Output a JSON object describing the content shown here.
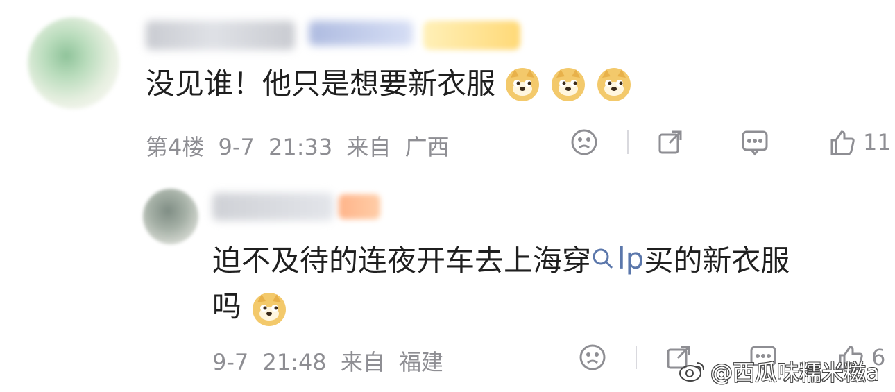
{
  "comment1": {
    "text": "没见谁！他只是想要新衣服",
    "emojis": [
      "doge",
      "doge",
      "doge"
    ],
    "meta": {
      "floor": "第4楼",
      "date": "9-7",
      "time": "21:33",
      "from_label": "来自",
      "location": "广西"
    },
    "actions": {
      "like_count": "11"
    }
  },
  "comment2": {
    "text_before": "迫不及待的连夜开车去上海穿",
    "link_text": "lp",
    "text_after": "买的新衣服",
    "line2": "吗",
    "emojis": [
      "doge"
    ],
    "meta": {
      "date": "9-7",
      "time": "21:48",
      "from_label": "来自",
      "location": "福建"
    },
    "actions": {
      "like_count": "6"
    }
  },
  "watermark": {
    "text": "@西瓜味糯米糍a"
  },
  "icons": [
    "avatar",
    "emoji-doge",
    "dislike-face-icon",
    "share-icon",
    "comment-icon",
    "thumb-up-icon",
    "search-link-icon",
    "weibo-logo"
  ],
  "colors": {
    "meta": "#8e8e93",
    "link": "#5b77ab",
    "text": "#1f1f1f"
  }
}
